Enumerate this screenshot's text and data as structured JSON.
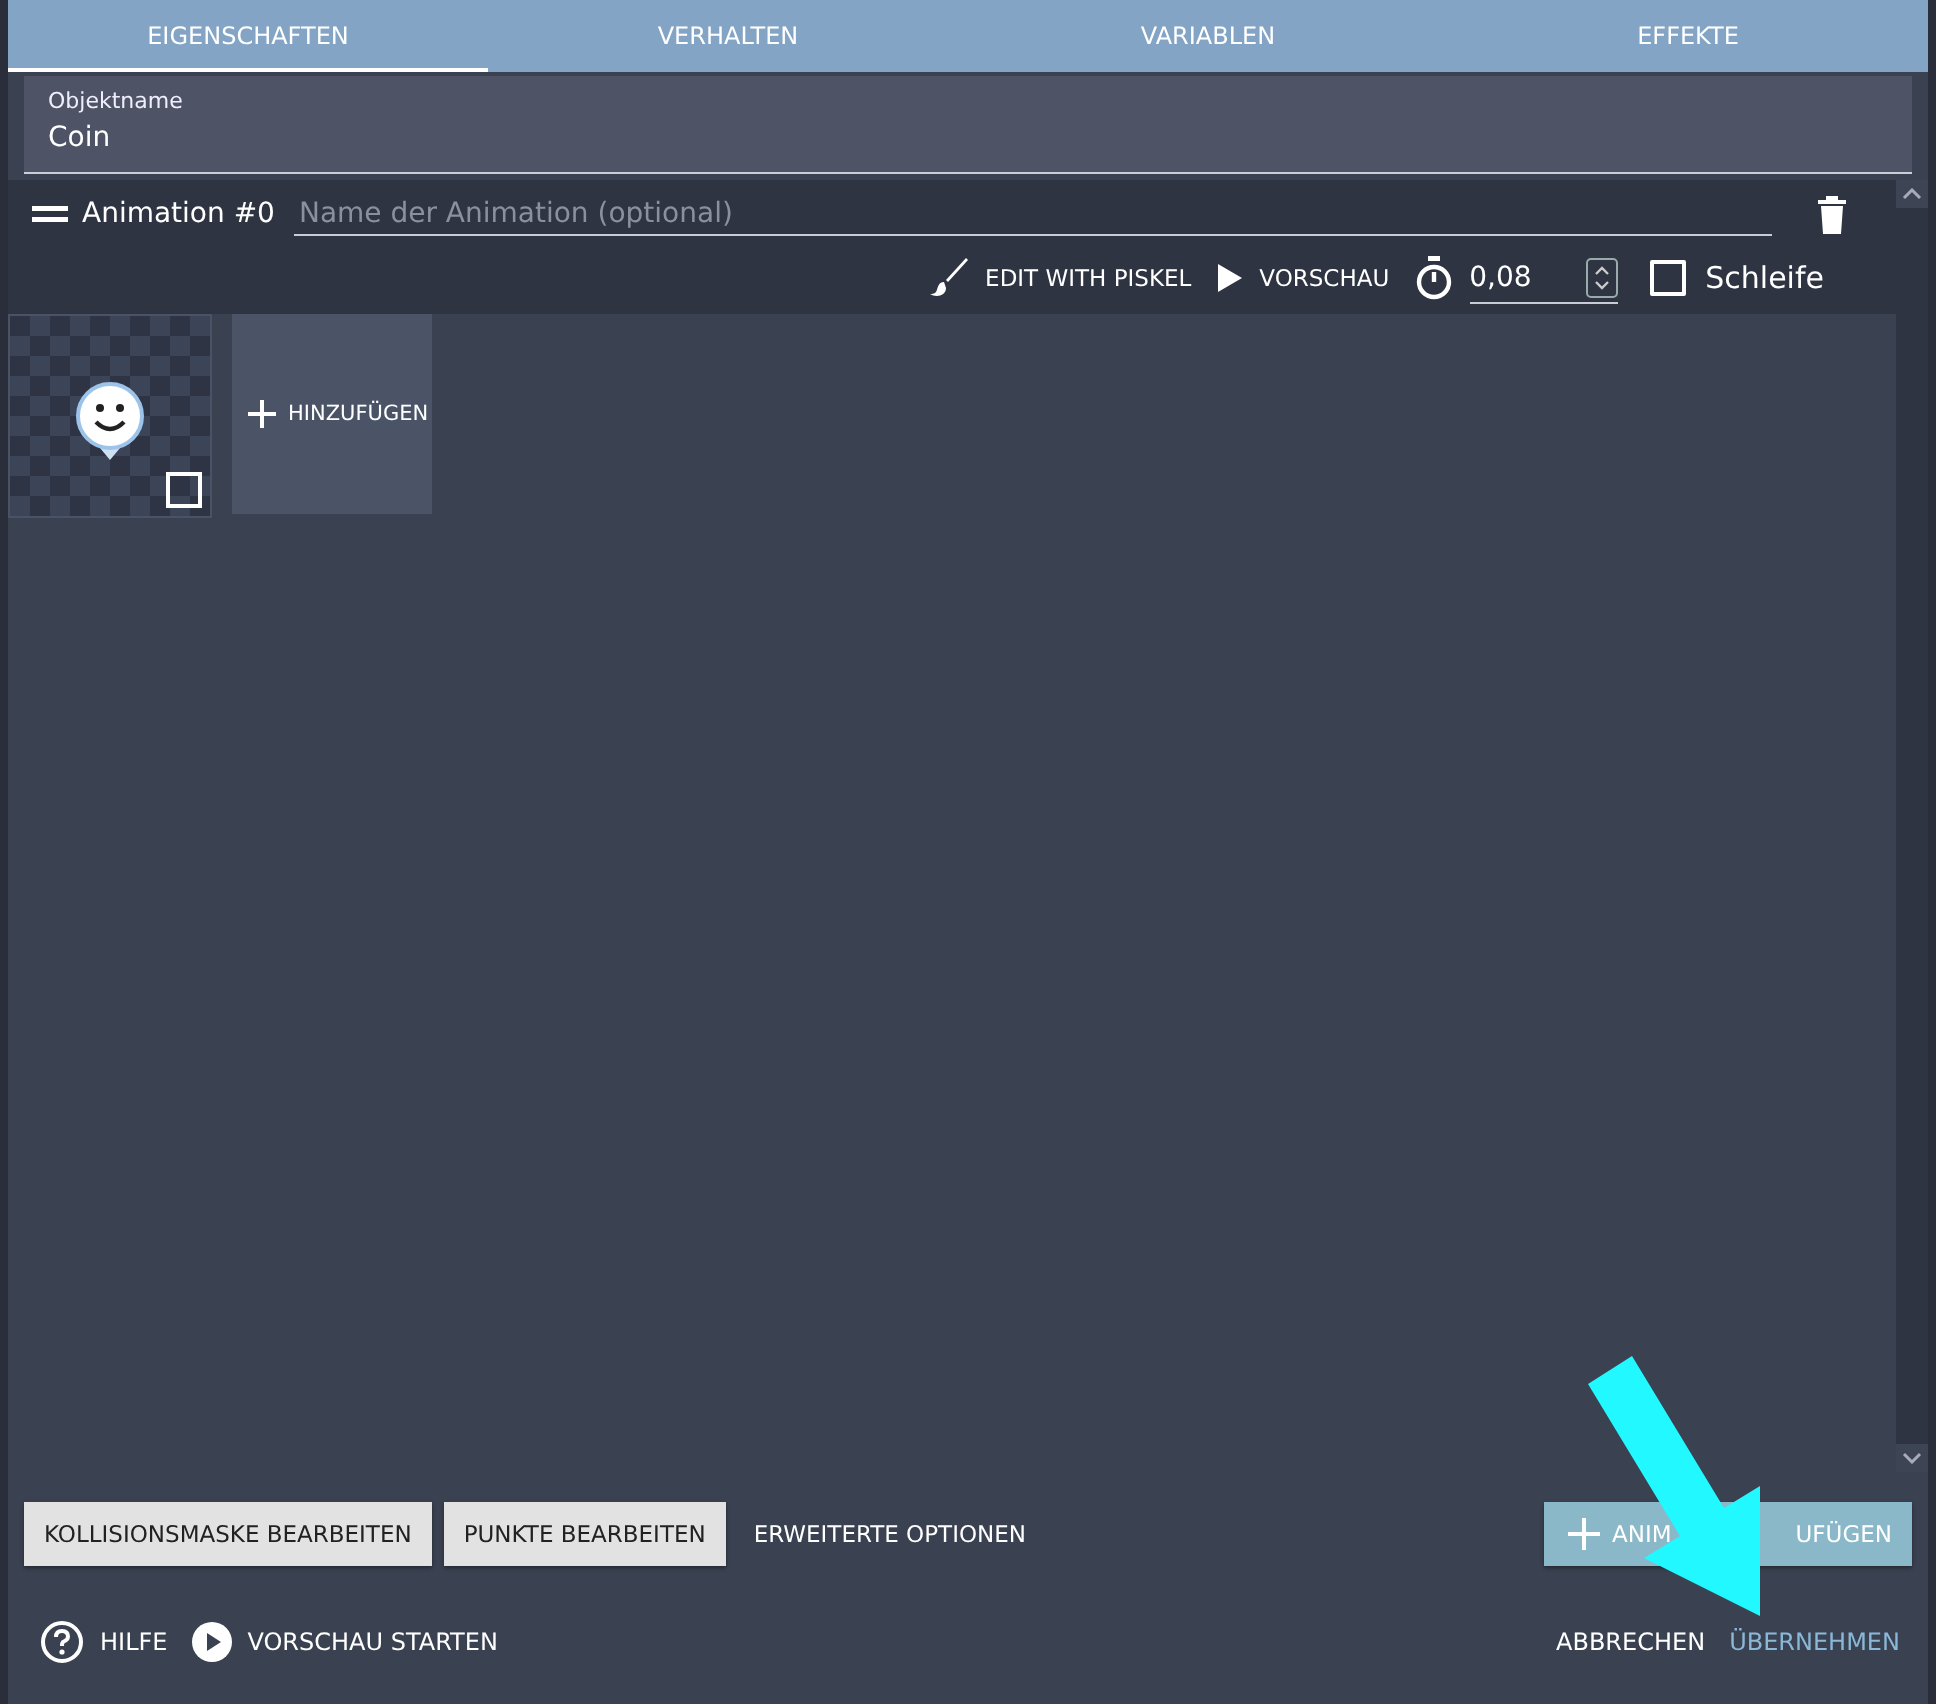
{
  "tabs": [
    {
      "label": "EIGENSCHAFTEN",
      "selected": true
    },
    {
      "label": "VERHALTEN",
      "selected": false
    },
    {
      "label": "VARIABLEN",
      "selected": false
    },
    {
      "label": "EFFEKTE",
      "selected": false
    }
  ],
  "object_name": {
    "label": "Objektname",
    "value": "Coin"
  },
  "animation": {
    "title": "Animation #0",
    "name_placeholder": "Name der Animation (optional)",
    "edit_button": "EDIT WITH PISKEL",
    "preview_button": "VORSCHAU",
    "frame_time": "0,08",
    "loop": {
      "label": "Schleife",
      "checked": false
    },
    "add_frame": "HINZUFÜGEN"
  },
  "bottom_buttons": [
    "KOLLISIONSMASKE BEARBEITEN",
    "PUNKTE BEARBEITEN"
  ],
  "advanced_options": "ERWEITERTE OPTIONEN",
  "add_animation_button": {
    "visible_label_parts": [
      "ANIM",
      "UFÜGEN"
    ]
  },
  "footer": {
    "help": "HILFE",
    "preview": "VORSCHAU STARTEN",
    "cancel": "ABBRECHEN",
    "apply": "ÜBERNEHMEN"
  },
  "overlay_arrow": true
}
